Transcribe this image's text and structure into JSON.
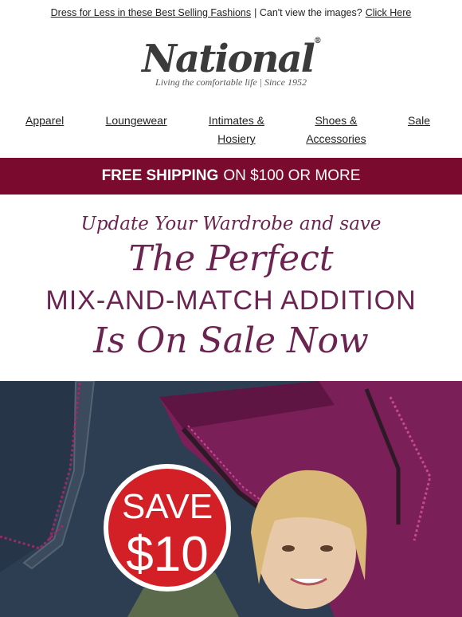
{
  "topbar": {
    "promo_link": "Dress for Less in these Best Selling Fashions",
    "separator_text": "| Can't view the images?",
    "click_here": "Click Here"
  },
  "logo": {
    "brand": "National",
    "tagline": "Living the comfortable life  |  Since 1952"
  },
  "nav": {
    "items": [
      {
        "line1": "Apparel",
        "line2": ""
      },
      {
        "line1": "Loungewear",
        "line2": ""
      },
      {
        "line1": "Intimates &",
        "line2": "Hosiery"
      },
      {
        "line1": "Shoes &",
        "line2": "Accessories"
      },
      {
        "line1": "Sale",
        "line2": ""
      }
    ]
  },
  "shipping": {
    "bold": "FREE SHIPPING",
    "rest": "ON $100 OR MORE"
  },
  "headline": {
    "line1": "Update Your Wardrobe and save",
    "line2": "The Perfect",
    "line3": "MIX-AND-MATCH ADDITION",
    "line4": "Is On Sale Now"
  },
  "badge": {
    "line1": "SAVE",
    "line2": "$10"
  },
  "colors": {
    "shipbar_bg": "#7a0b2e",
    "headline": "#6b2450",
    "badge_red": "#d31f26"
  }
}
